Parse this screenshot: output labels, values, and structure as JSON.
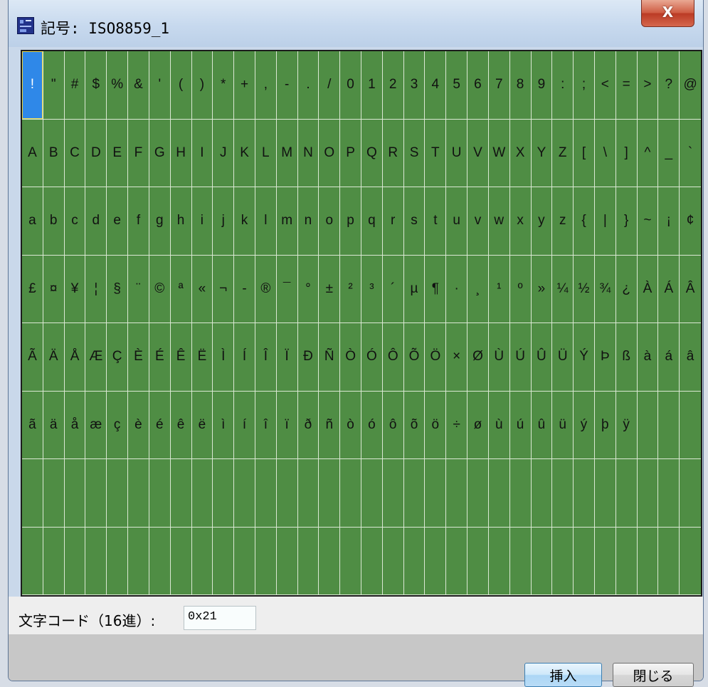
{
  "window": {
    "title": "記号: ISO8859_1",
    "close_label": "X"
  },
  "charmap": {
    "columns": 32,
    "rows": 8,
    "selected_index": 0,
    "cells": [
      "!",
      "\"",
      "#",
      "$",
      "%",
      "&",
      "'",
      "(",
      ")",
      "*",
      "+",
      ",",
      "-",
      ".",
      "/",
      "0",
      "1",
      "2",
      "3",
      "4",
      "5",
      "6",
      "7",
      "8",
      "9",
      ":",
      ";",
      "<",
      "=",
      ">",
      "?",
      "@",
      "A",
      "B",
      "C",
      "D",
      "E",
      "F",
      "G",
      "H",
      "I",
      "J",
      "K",
      "L",
      "M",
      "N",
      "O",
      "P",
      "Q",
      "R",
      "S",
      "T",
      "U",
      "V",
      "W",
      "X",
      "Y",
      "Z",
      "[",
      "\\",
      "]",
      "^",
      "_",
      "`",
      "a",
      "b",
      "c",
      "d",
      "e",
      "f",
      "g",
      "h",
      "i",
      "j",
      "k",
      "l",
      "m",
      "n",
      "o",
      "p",
      "q",
      "r",
      "s",
      "t",
      "u",
      "v",
      "w",
      "x",
      "y",
      "z",
      "{",
      "|",
      "}",
      "~",
      "¡",
      "¢",
      "£",
      "¤",
      "¥",
      "¦",
      "§",
      "¨",
      "©",
      "ª",
      "«",
      "¬",
      "-",
      "®",
      "¯",
      "°",
      "±",
      "²",
      "³",
      "´",
      "µ",
      "¶",
      "·",
      "¸",
      "¹",
      "º",
      "»",
      "¼",
      "½",
      "¾",
      "¿",
      "À",
      "Á",
      "Â",
      "Ã",
      "Ä",
      "Å",
      "Æ",
      "Ç",
      "È",
      "É",
      "Ê",
      "Ë",
      "Ì",
      "Í",
      "Î",
      "Ï",
      "Ð",
      "Ñ",
      "Ò",
      "Ó",
      "Ô",
      "Õ",
      "Ö",
      "×",
      "Ø",
      "Ù",
      "Ú",
      "Û",
      "Ü",
      "Ý",
      "Þ",
      "ß",
      "à",
      "á",
      "â",
      "ã",
      "ä",
      "å",
      "æ",
      "ç",
      "è",
      "é",
      "ê",
      "ë",
      "ì",
      "í",
      "î",
      "ï",
      "ð",
      "ñ",
      "ò",
      "ó",
      "ô",
      "õ",
      "ö",
      "÷",
      "ø",
      "ù",
      "ú",
      "û",
      "ü",
      "ý",
      "þ",
      "ÿ",
      "",
      "",
      "",
      "",
      "",
      "",
      "",
      "",
      "",
      "",
      "",
      "",
      "",
      "",
      "",
      "",
      "",
      "",
      "",
      "",
      "",
      "",
      "",
      "",
      "",
      "",
      "",
      "",
      "",
      "",
      "",
      "",
      "",
      "",
      "",
      "",
      "",
      "",
      "",
      "",
      "",
      "",
      "",
      "",
      "",
      "",
      "",
      "",
      "",
      "",
      "",
      "",
      "",
      "",
      "",
      "",
      "",
      "",
      "",
      "",
      "",
      "",
      "",
      "",
      "",
      "",
      ""
    ]
  },
  "code": {
    "label": "文字コード（16進）:",
    "value": "0x21"
  },
  "buttons": {
    "insert": "挿入",
    "close": "閉じる"
  },
  "colors": {
    "grid_bg": "#4f8d44",
    "selected_bg": "#2f88e8"
  }
}
